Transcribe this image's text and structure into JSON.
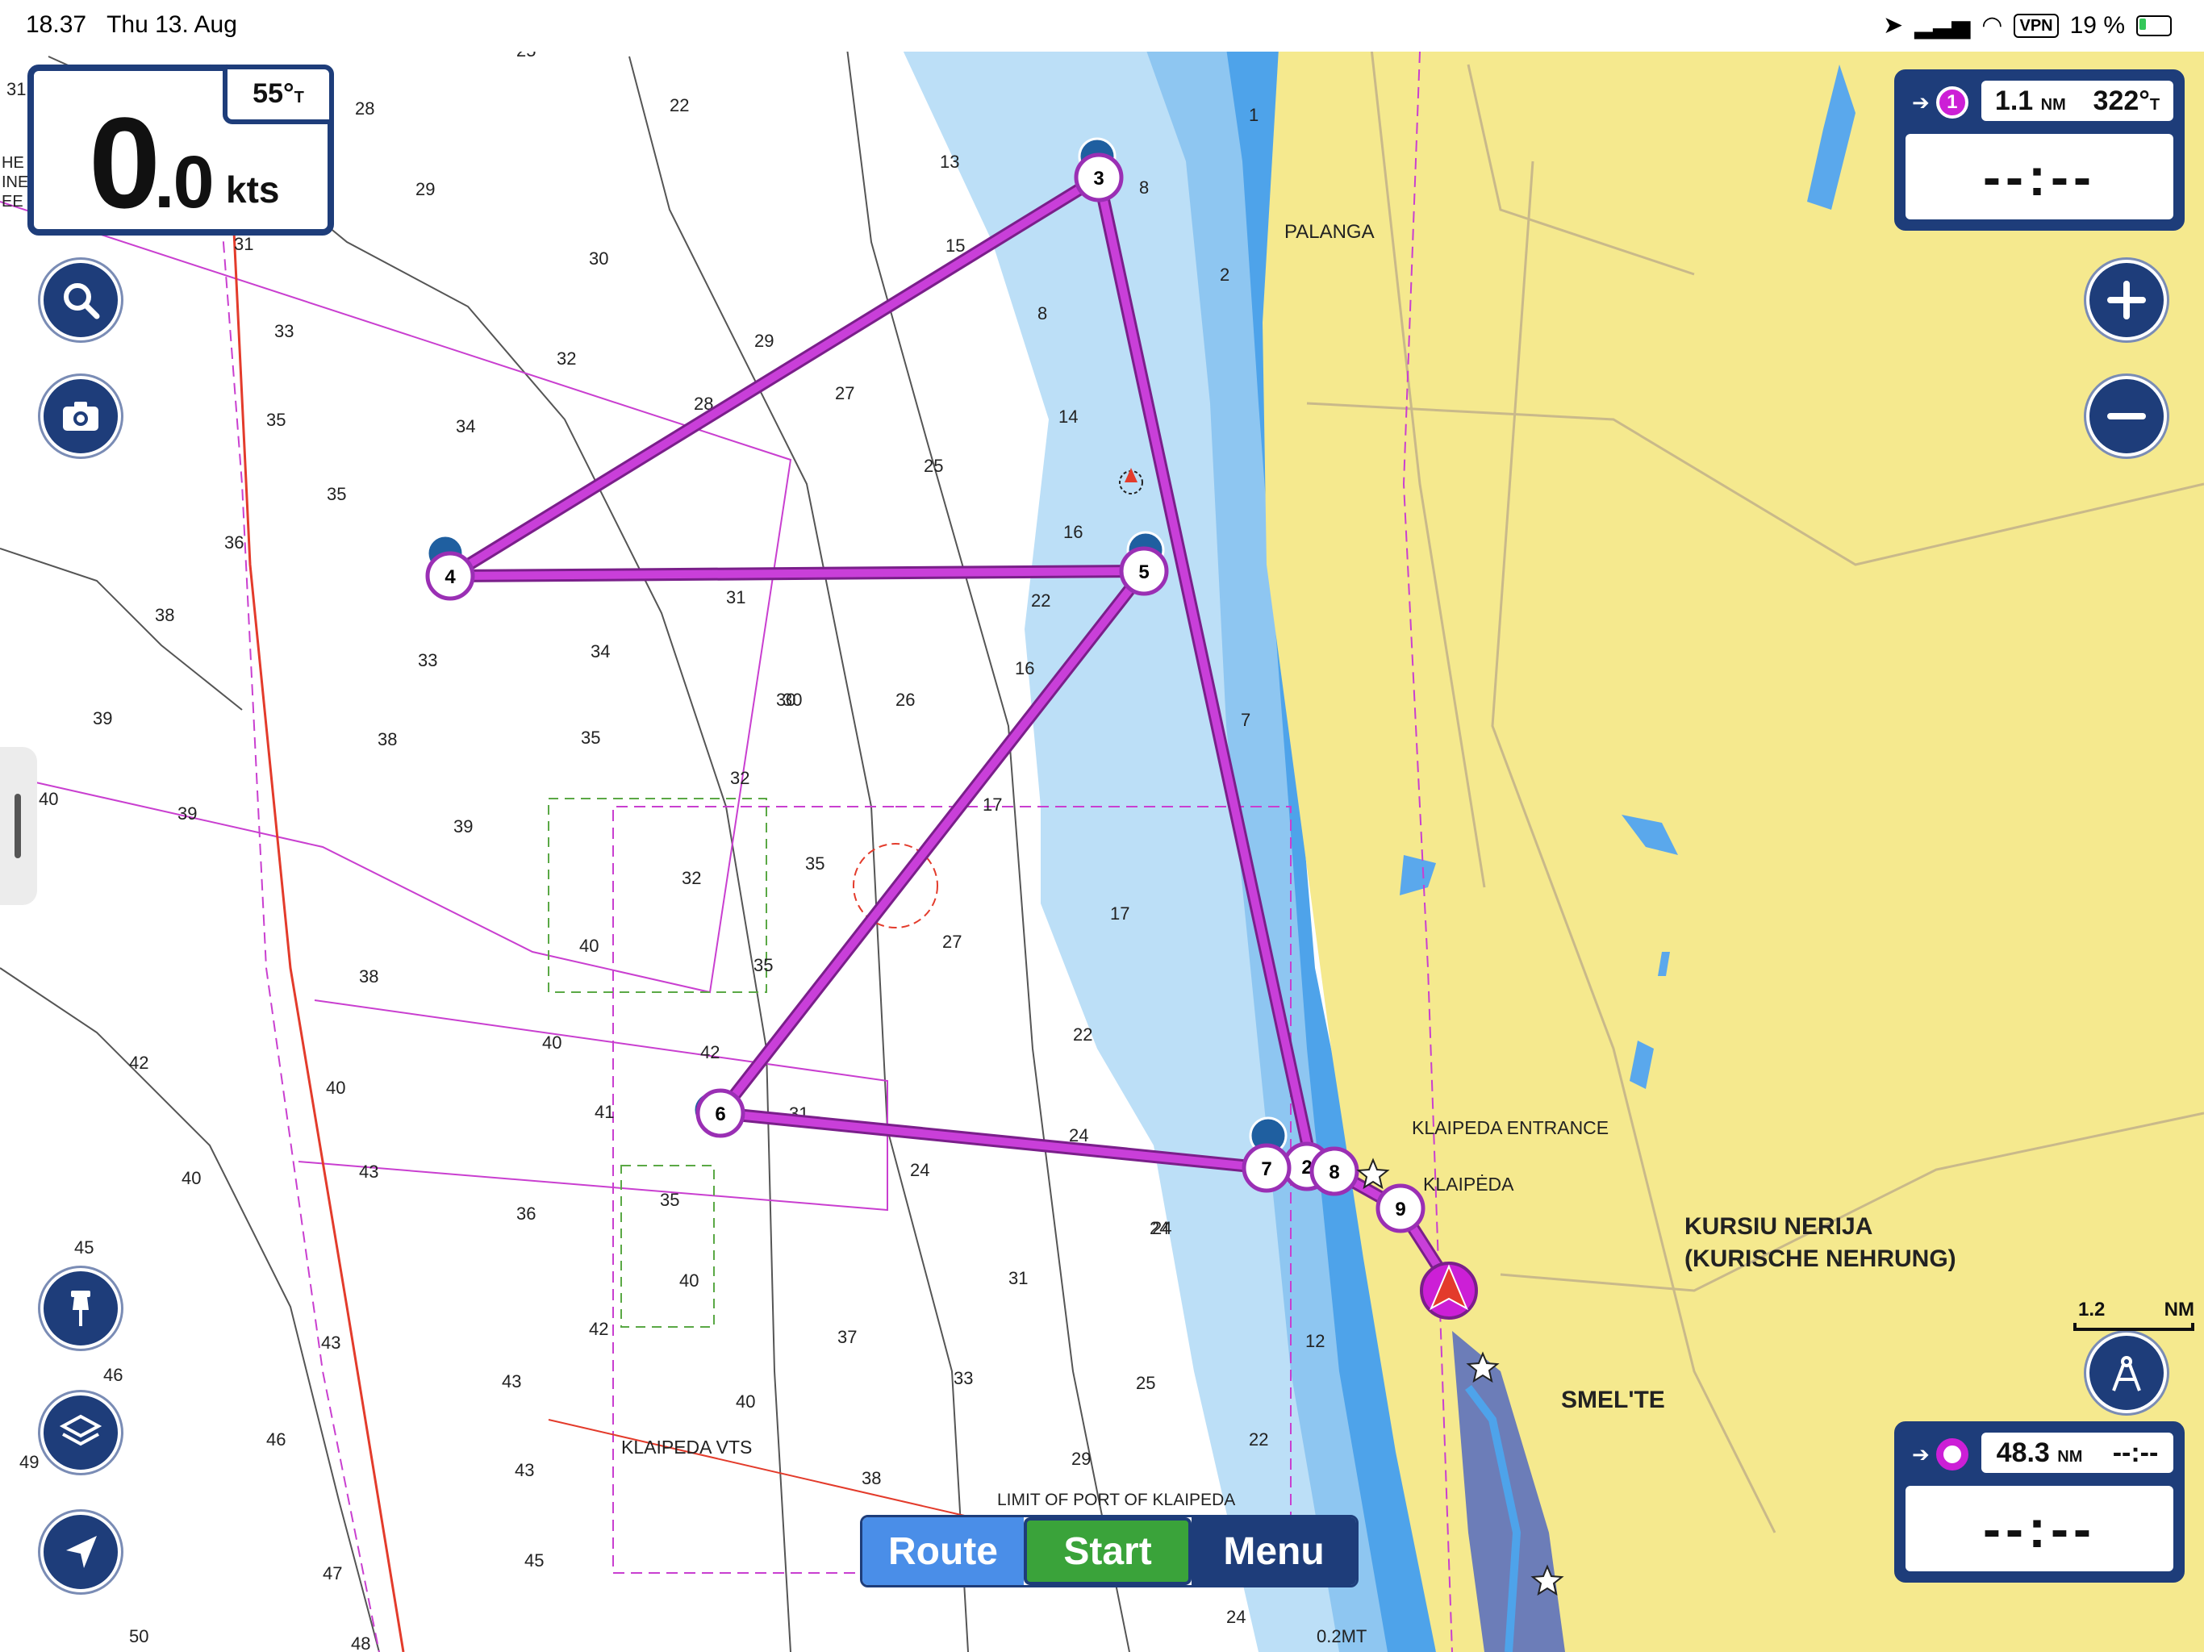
{
  "status_bar": {
    "time": "18.37",
    "date": "Thu 13. Aug",
    "vpn": "VPN",
    "battery": "19 %"
  },
  "speed": {
    "int": "0",
    "dec": ".0",
    "unit": "kts",
    "heading": "55°",
    "heading_ref": "T"
  },
  "nav_top": {
    "waypoint_num": "1",
    "distance": "1.1",
    "distance_unit": "NM",
    "bearing": "322°",
    "bearing_ref": "T",
    "time": "--:--"
  },
  "nav_bottom": {
    "distance": "48.3",
    "distance_unit": "NM",
    "eta": "--:--",
    "time": "--:--"
  },
  "scale": {
    "value": "1.2",
    "unit": "NM"
  },
  "toolbar": {
    "route": "Route",
    "start": "Start",
    "menu": "Menu"
  },
  "map_labels": {
    "palanga": "PALANGA",
    "klaipeda_entrance": "KLAIPEDA ENTRANCE",
    "klaipeda": "KLAIPĖDA",
    "kursiu": "KURSIU NERIJA",
    "kurische": "(KURISCHE NEHRUNG)",
    "smelte": "SMEL'TE",
    "klaipeda_vts": "KLAIPEDA VTS",
    "limit_port": "LIMIT OF PORT OF KLAIPEDA",
    "mt": "0.2MT",
    "edge_top": "HE",
    "edge_mid": "INE",
    "edge_low": "EE"
  },
  "waypoints": [
    "3",
    "4",
    "5",
    "6",
    "7",
    "2",
    "8",
    "9"
  ],
  "depths": [
    "31",
    "28",
    "22",
    "25",
    "29",
    "30",
    "32",
    "33",
    "34",
    "35",
    "35",
    "36",
    "38",
    "33",
    "34",
    "39",
    "38",
    "35",
    "39",
    "40",
    "39",
    "30",
    "31",
    "29",
    "27",
    "28",
    "25",
    "14",
    "16",
    "22",
    "16",
    "26",
    "30",
    "32",
    "35",
    "32",
    "35",
    "27",
    "22",
    "40",
    "38",
    "42",
    "42",
    "40",
    "41",
    "43",
    "36",
    "31",
    "24",
    "35",
    "40",
    "42",
    "43",
    "45",
    "46",
    "43",
    "43",
    "46",
    "49",
    "47",
    "45",
    "50",
    "48",
    "38",
    "40",
    "37",
    "33",
    "31",
    "24",
    "29",
    "25",
    "22",
    "24",
    "38",
    "13",
    "15",
    "8",
    "8",
    "12",
    "1",
    "7",
    "2",
    "17",
    "32",
    "13"
  ],
  "colors": {
    "land": "#f5e98e",
    "shallow": "#a9d6f5",
    "mid": "#7cbdf0",
    "deep": "#4ea3ea",
    "route": "#bb2fd1",
    "panel": "#1e3d7a"
  }
}
